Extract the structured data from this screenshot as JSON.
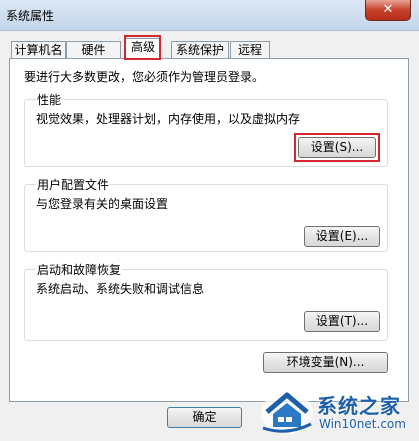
{
  "window": {
    "title": "系统属性",
    "close_label": "✕"
  },
  "tabs": [
    {
      "label": "计算机名"
    },
    {
      "label": "硬件"
    },
    {
      "label": "高级",
      "active": true
    },
    {
      "label": "系统保护"
    },
    {
      "label": "远程"
    }
  ],
  "admin_note": "要进行大多数更改，您必须作为管理员登录。",
  "performance": {
    "title": "性能",
    "description": "视觉效果，处理器计划，内存使用，以及虚拟内存",
    "button_label": "设置(S)..."
  },
  "user_profiles": {
    "title": "用户配置文件",
    "description": "与您登录有关的桌面设置",
    "button_label": "设置(E)..."
  },
  "startup_recovery": {
    "title": "启动和故障恢复",
    "description": "系统启动、系统失败和调试信息",
    "button_label": "设置(T)..."
  },
  "env_button_label": "环境变量(N)...",
  "footer": {
    "ok_label": "确定"
  },
  "watermark": {
    "name": "系统之家",
    "url": "Win10net.com"
  },
  "colors": {
    "highlight": "#d6262f",
    "brand": "#1f5fa8"
  }
}
